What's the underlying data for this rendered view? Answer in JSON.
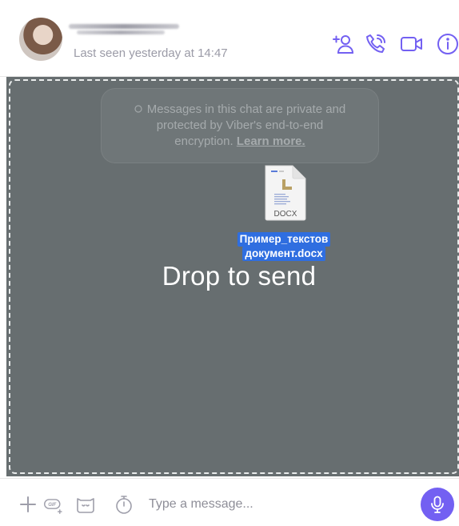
{
  "header": {
    "last_seen": "Last seen yesterday at 14:47",
    "icons": {
      "add_participant": "add-participant-icon",
      "call": "phone-call-icon",
      "video": "video-camera-icon",
      "info": "info-icon"
    }
  },
  "chat": {
    "e2e_notice": {
      "line1": "Messages in this chat are private and",
      "line2": "protected by Viber's end-to-end",
      "line3_prefix": "encryption. ",
      "learn_more": "Learn more."
    },
    "dragged_file": {
      "type_label": "DOCX",
      "name_line1": "Пример_текстов",
      "name_line2": "документ.docx"
    },
    "drop_label": "Drop to send"
  },
  "composer": {
    "placeholder": "Type a message...",
    "icons": {
      "plus": "plus-icon",
      "gif": "gif-icon",
      "sticker": "sticker-icon",
      "timer": "timer-icon",
      "mic": "microphone-icon"
    }
  },
  "colors": {
    "accent": "#7360f2",
    "overlay": "#676e70",
    "selection": "#2f6ee0",
    "muted_text": "#9b9ba7"
  }
}
